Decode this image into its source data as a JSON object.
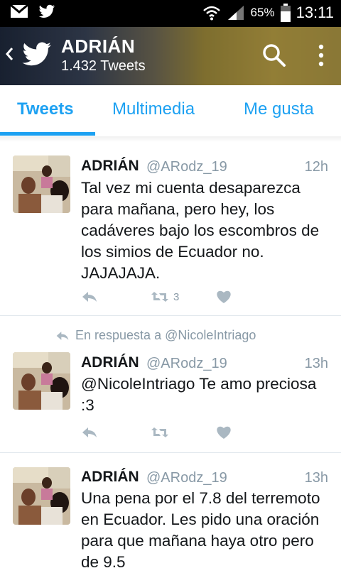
{
  "statusbar": {
    "battery_percent": "65%",
    "time": "13:11",
    "icons": [
      "gmail-icon",
      "twitter-icon",
      "wifi-icon",
      "signal-icon",
      "battery-icon"
    ]
  },
  "header": {
    "name": "ADRIÁN",
    "tweet_count": "1.432 Tweets",
    "icons": [
      "back-arrow-icon",
      "twitter-bird-icon",
      "search-icon",
      "more-vert-icon"
    ]
  },
  "tabs": [
    {
      "label": "Tweets",
      "active": true
    },
    {
      "label": "Multimedia",
      "active": false
    },
    {
      "label": "Me gusta",
      "active": false
    }
  ],
  "tweets": [
    {
      "name": "ADRIÁN",
      "handle": "@ARodz_19",
      "time": "12h",
      "text": "Tal vez mi cuenta desaparezca para mañana, pero hey, los cadáveres bajo los escombros de los simios de Ecuador no. JAJAJAJA.",
      "retweets": "3"
    },
    {
      "reply_to": "En respuesta a @NicoleIntriago",
      "name": "ADRIÁN",
      "handle": "@ARodz_19",
      "time": "13h",
      "text": "@NicoleIntriago Te amo preciosa :3",
      "retweets": ""
    },
    {
      "name": "ADRIÁN",
      "handle": "@ARodz_19",
      "time": "13h",
      "text": "Una pena por el 7.8 del terremoto en Ecuador. Les pido una oración para que mañana haya otro pero de 9.5"
    }
  ],
  "colors": {
    "accent": "#1da1f2",
    "muted": "#8899a6",
    "text": "#14171a"
  }
}
